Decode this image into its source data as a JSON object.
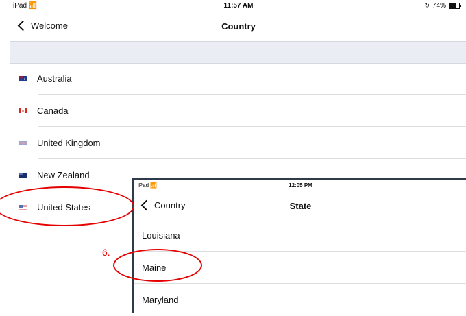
{
  "country_screen": {
    "status": {
      "device": "iPad",
      "time": "11:57 AM",
      "battery": "74%"
    },
    "nav": {
      "back_label": "Welcome",
      "title": "Country"
    },
    "countries": [
      {
        "label": "Australia",
        "flag": "australia-flag"
      },
      {
        "label": "Canada",
        "flag": "canada-flag"
      },
      {
        "label": "United Kingdom",
        "flag": "uk-flag"
      },
      {
        "label": "New Zealand",
        "flag": "new-zealand-flag"
      },
      {
        "label": "United States",
        "flag": "us-flag"
      }
    ]
  },
  "state_screen": {
    "status": {
      "device": "iPad",
      "time": "12:05 PM"
    },
    "nav": {
      "back_label": "Country",
      "title": "State"
    },
    "states": [
      "Louisiana",
      "Maine",
      "Maryland"
    ]
  },
  "annotations": {
    "step_label": "6.",
    "colors": {
      "annotation": "#e60000"
    }
  },
  "colors": {
    "section_band": "#ebedf5",
    "frame": "#2f3a4a"
  }
}
